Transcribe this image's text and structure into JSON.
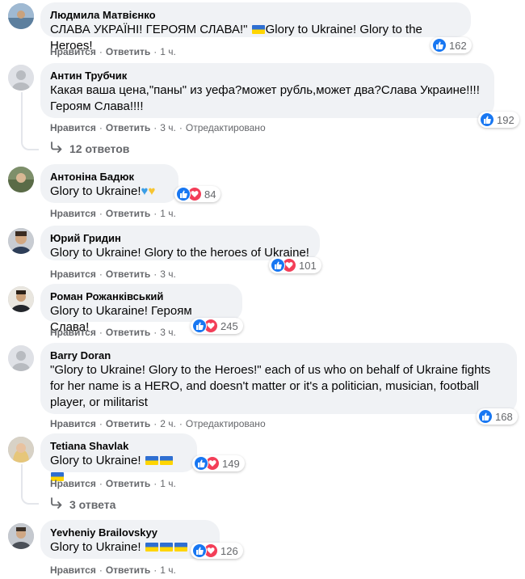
{
  "actions": {
    "like": "Нравится",
    "reply": "Ответить",
    "edited": "Отредактировано"
  },
  "comments": [
    {
      "author": "Людмила Матвієнко",
      "text": "СЛАВА УКРАЇНІ! ГЕРОЯМ СЛАВА!\"",
      "text_after": "Glory to Ukraine! Glory to the Heroes!",
      "reactions": "162",
      "time": "1 ч."
    },
    {
      "author": "Антин Трубчик",
      "text": "Какая ваша цена,\"паны\" из уефа?может рубль,может два?Слава Украине!!!!\nГероям Слава!!!!",
      "reactions": "192",
      "time": "3 ч."
    },
    {
      "author": "Антоніна Бадюк",
      "text": "Glory to Ukraine!",
      "reactions": "84",
      "time": "1 ч."
    },
    {
      "author": "Юрий Гридин",
      "text": "Glory to Ukraine! Glory to the heroes of Ukraine!",
      "reactions": "101",
      "time": "3 ч."
    },
    {
      "author": "Роман Рожанківський",
      "text": "Glory to Ukaraine! Героям Слава!",
      "reactions": "245",
      "time": "3 ч."
    },
    {
      "author": "Barry Doran",
      "text": "\"Glory to Ukraine! Glory to the Heroes!\" each of us who on behalf of Ukraine fights\nfor her name is a HERO, and doesn't matter or it's a politician, musician, football\nplayer, or militarist",
      "reactions": "168",
      "time": "2 ч."
    },
    {
      "author": "Tetiana Shavlak",
      "text": "Glory to Ukraine!",
      "reactions": "149",
      "time": "1 ч."
    },
    {
      "author": "Yevheniy Brailovskyy",
      "text": "Glory to Ukraine!",
      "reactions": "126",
      "time": "1 ч."
    }
  ],
  "replies": [
    {
      "label": "12 ответов"
    },
    {
      "label": "3 ответа"
    }
  ],
  "colors": {
    "bubble": "#f0f2f5",
    "like": "#1877f2",
    "love": "#f33e58",
    "meta": "#65676b"
  },
  "icons": [
    "like-icon",
    "love-icon",
    "reply-arrow-icon",
    "flag-ukraine-icon",
    "blue-heart-icon",
    "yellow-heart-icon"
  ]
}
